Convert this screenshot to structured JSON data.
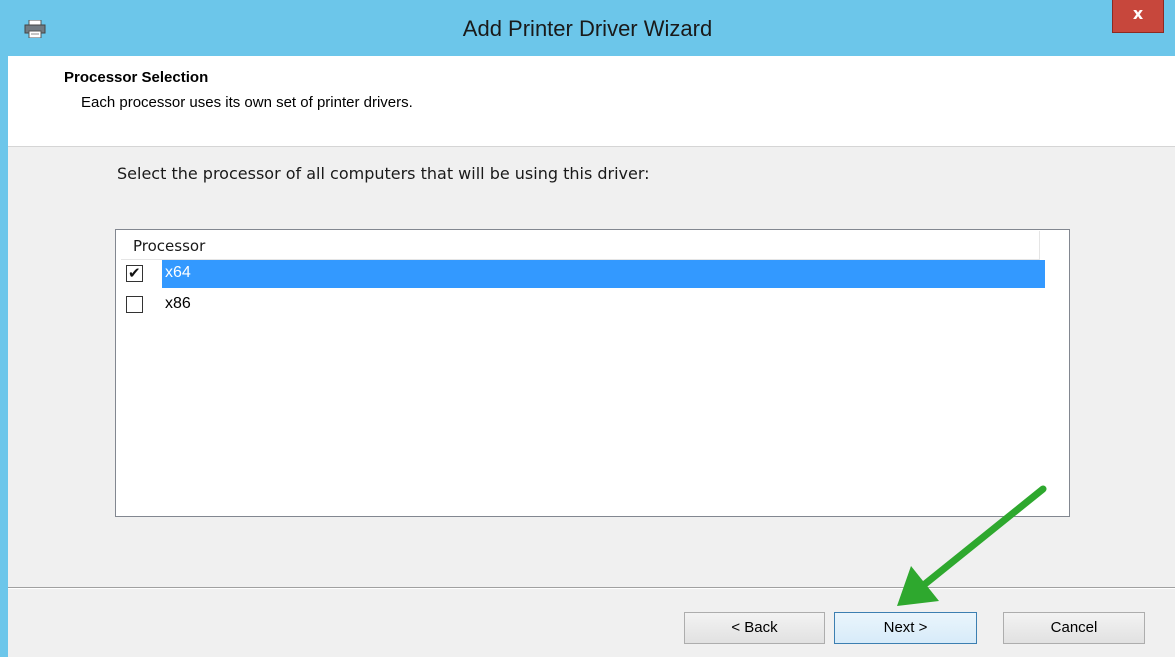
{
  "window": {
    "title": "Add Printer Driver Wizard",
    "close_label": "x"
  },
  "header": {
    "title": "Processor Selection",
    "subtitle": "Each processor uses its own set of printer drivers."
  },
  "main": {
    "instruction": "Select the processor of all computers that will be using this driver:",
    "list": {
      "column_header": "Processor",
      "items": [
        {
          "label": "x64",
          "checked": true,
          "selected": true
        },
        {
          "label": "x86",
          "checked": false,
          "selected": false
        }
      ]
    }
  },
  "buttons": {
    "back": "< Back",
    "next": "Next >",
    "cancel": "Cancel"
  },
  "annotation": {
    "arrow_color": "#2ea82e",
    "arrow_target": "next-button"
  },
  "colors": {
    "titlebar": "#6cc6ea",
    "selection": "#3399ff",
    "close_button": "#c7473c"
  },
  "icons": {
    "title_icon": "printer-icon",
    "close_icon": "close-icon",
    "check_icon": "checkmark-icon"
  }
}
